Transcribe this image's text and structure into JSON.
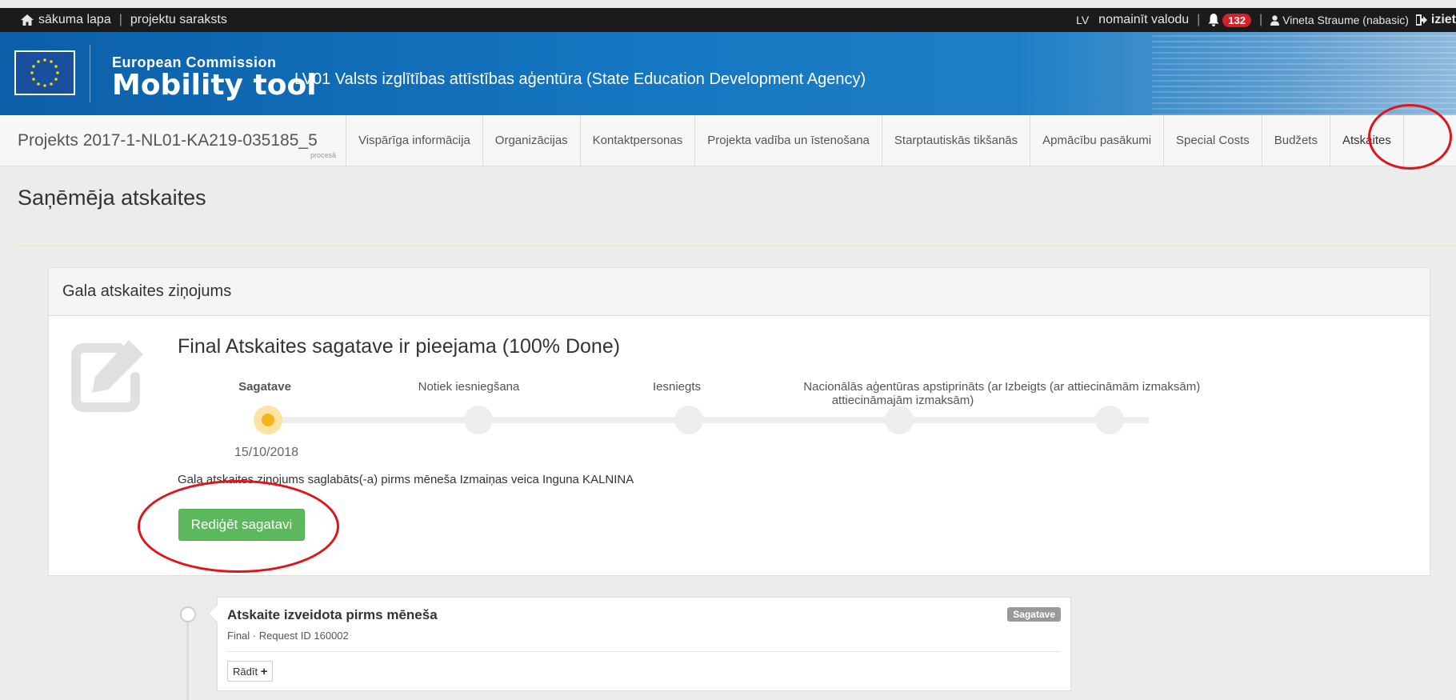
{
  "topbar": {
    "home": "sākuma lapa",
    "sep1": "|",
    "projects": "projektu saraksts",
    "lang": "LV",
    "change_lang": "nomainīt valodu",
    "sep2": "|",
    "notifications": "132",
    "sep3": "|",
    "user": "Vineta Straume (nabasic)",
    "logout": "iziet"
  },
  "header": {
    "org": "European Commission",
    "tool": "Mobility tool",
    "agency": "LV01 Valsts izglītības attīstības aģentūra (State Education Development Agency)"
  },
  "nav": {
    "project": "Projekts 2017-1-NL01-KA219-035185_5",
    "project_status": "procesā",
    "items": [
      "Vispārīga informācija",
      "Organizācijas",
      "Kontaktpersonas",
      "Projekta vadība un īstenošana",
      "Starptautiskās tikšanās",
      "Apmācību pasākumi",
      "Special Costs",
      "Budžets",
      "Atskaites"
    ]
  },
  "page": {
    "title": "Saņēmēja atskaites"
  },
  "panel": {
    "heading": "Gala atskaites ziņojums",
    "final_title": "Final Atskaites sagatave ir pieejama (100% Done)",
    "steps": [
      "Sagatave",
      "Notiek iesniegšana",
      "Iesniegts",
      "Nacionālās aģentūras apstiprināts (ar attiecināmajām izmaksām)",
      "Izbeigts (ar attiecināmām izmaksām)"
    ],
    "date": "15/10/2018",
    "saved_note": "Gala atskaites ziņojums saglabāts(-a) pirms mēneša Izmaiņas veica Inguna KALNINA",
    "edit_button": "Rediģēt sagatavi"
  },
  "timeline": {
    "title": "Atskaite izveidota pirms mēneša",
    "subtitle": "Final · Request ID 160002",
    "badge": "Sagatave",
    "show_button": "Rādīt"
  },
  "colors": {
    "annotation": "#e0151b",
    "edit_button": "#5cb85c",
    "active_step": "#f4b41a",
    "badge": "#d2232a"
  }
}
